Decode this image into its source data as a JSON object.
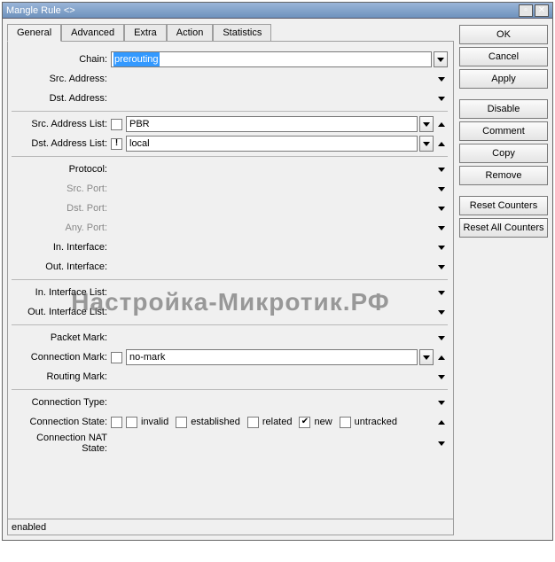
{
  "window": {
    "title": "Mangle Rule <>"
  },
  "tabs": [
    "General",
    "Advanced",
    "Extra",
    "Action",
    "Statistics"
  ],
  "active_tab": "General",
  "labels": {
    "chain": "Chain:",
    "src_addr": "Src. Address:",
    "dst_addr": "Dst. Address:",
    "src_list": "Src. Address List:",
    "dst_list": "Dst. Address List:",
    "protocol": "Protocol:",
    "src_port": "Src. Port:",
    "dst_port": "Dst. Port:",
    "any_port": "Any. Port:",
    "in_if": "In. Interface:",
    "out_if": "Out. Interface:",
    "in_if_list": "In. Interface List:",
    "out_if_list": "Out. Interface List:",
    "packet_mark": "Packet Mark:",
    "conn_mark": "Connection Mark:",
    "routing_mark": "Routing Mark:",
    "conn_type": "Connection Type:",
    "conn_state": "Connection State:",
    "conn_nat": "Connection NAT State:"
  },
  "values": {
    "chain": "prerouting",
    "src_list": "PBR",
    "dst_list": "local",
    "dst_list_invert": "!",
    "conn_mark": "no-mark"
  },
  "conn_state_options": {
    "invalid": "invalid",
    "established": "established",
    "related": "related",
    "new": "new",
    "untracked": "untracked"
  },
  "conn_state_checked": {
    "new": true
  },
  "buttons": {
    "ok": "OK",
    "cancel": "Cancel",
    "apply": "Apply",
    "disable": "Disable",
    "comment": "Comment",
    "copy": "Copy",
    "remove": "Remove",
    "reset_counters": "Reset Counters",
    "reset_all_counters": "Reset All Counters"
  },
  "status": "enabled",
  "watermark": "Настройка-Микротик.РФ"
}
